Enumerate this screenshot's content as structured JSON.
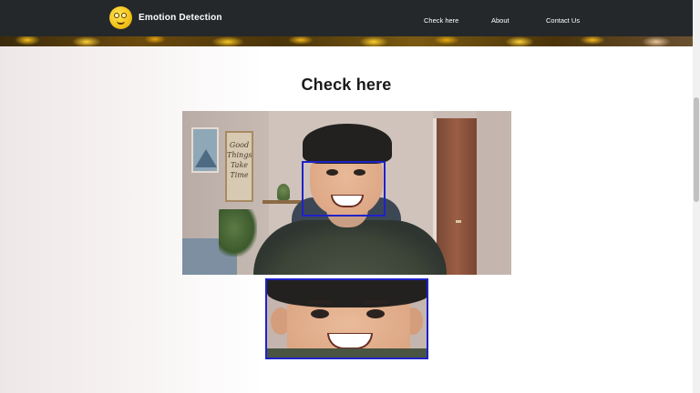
{
  "navbar": {
    "brand": "Emotion Detection",
    "logo_icon": "emoji-face-icon",
    "links": [
      "Check here",
      "About",
      "Contact Us"
    ]
  },
  "main": {
    "heading": "Check here",
    "camera": {
      "detection_box_color": "#1f22c8",
      "detection_label_color": "#e01010",
      "poster_text": "Good Things Take Time"
    }
  },
  "colors": {
    "navbar_bg": "#24282b",
    "heading": "#1a1a1a"
  }
}
